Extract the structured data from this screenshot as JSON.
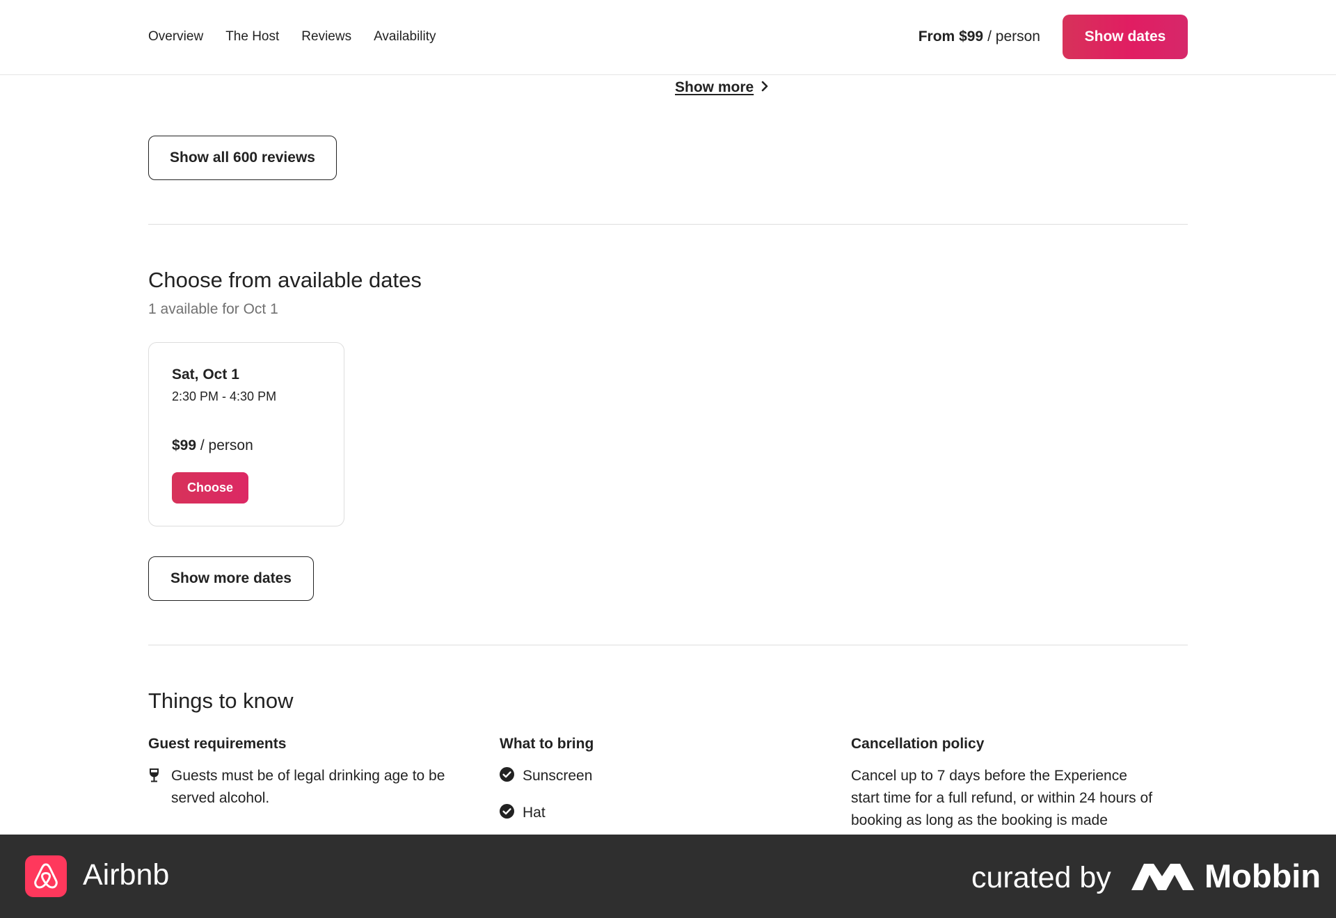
{
  "nav": {
    "items": [
      "Overview",
      "The Host",
      "Reviews",
      "Availability"
    ]
  },
  "header": {
    "price_prefix": "From $99",
    "price_unit": "/ person",
    "cta_label": "Show dates"
  },
  "reviews": {
    "show_more_label": "Show more",
    "show_all_label": "Show all 600 reviews"
  },
  "dates": {
    "title": "Choose from available dates",
    "subtitle": "1 available for Oct 1",
    "card": {
      "date": "Sat, Oct 1",
      "time": "2:30 PM - 4:30 PM",
      "price": "$99",
      "price_unit": "/ person",
      "choose_label": "Choose"
    },
    "show_more_dates_label": "Show more dates"
  },
  "things_to_know": {
    "title": "Things to know",
    "guest_requirements": {
      "heading": "Guest requirements",
      "items": [
        "Guests must be of legal drinking age to be served alcohol."
      ]
    },
    "what_to_bring": {
      "heading": "What to bring",
      "items": [
        "Sunscreen",
        "Hat"
      ]
    },
    "cancellation": {
      "heading": "Cancellation policy",
      "text": "Cancel up to 7 days before the Experience start time for a full refund, or within 24 hours of booking as long as the booking is made"
    }
  },
  "footer": {
    "app_name": "Airbnb",
    "curated_by": "curated by",
    "brand": "Mobbin"
  },
  "colors": {
    "accent": "#e11d62",
    "text": "#222222",
    "muted": "#717171",
    "footer_bg": "#2f2f2f",
    "airbnb": "#ff385c"
  }
}
